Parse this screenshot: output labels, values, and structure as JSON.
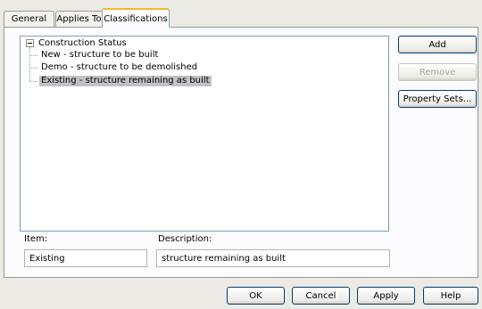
{
  "tabs": [
    {
      "label": "General"
    },
    {
      "label": "Applies To"
    },
    {
      "label": "Classifications",
      "active": true
    }
  ],
  "tree": {
    "root": "Construction Status",
    "children": [
      {
        "label": "New - structure to be built"
      },
      {
        "label": "Demo - structure to be demolished"
      },
      {
        "label": "Existing - structure remaining as built",
        "selected": true
      }
    ]
  },
  "side_buttons": {
    "add": "Add",
    "remove": "Remove",
    "property_sets": "Property Sets..."
  },
  "item": {
    "label": "Item:",
    "value": "Existing"
  },
  "description": {
    "label": "Description:",
    "value": "structure remaining as built"
  },
  "footer": {
    "ok": "OK",
    "cancel": "Cancel",
    "apply": "Apply",
    "help": "Help"
  }
}
